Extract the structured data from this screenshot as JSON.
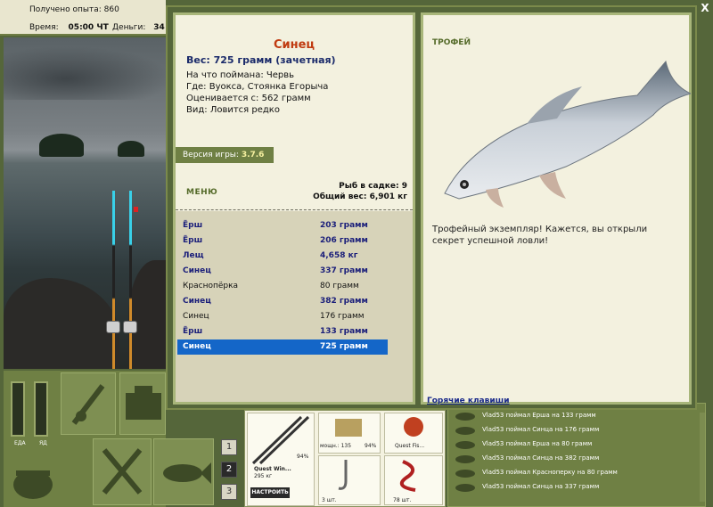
{
  "status": {
    "experience_label": "Получено опыта:",
    "experience_value": "860",
    "time_label": "Время:",
    "time_value": "05:00 ЧТ",
    "money_label": "Деньги:",
    "money_value": "34"
  },
  "gauges": {
    "left_label": "ЕДА",
    "right_label": "ЯД"
  },
  "page_buttons": [
    "1",
    "2",
    "3"
  ],
  "gear": {
    "rod_name": "Quest Win...",
    "rod_weight": "295 кг",
    "rod_percent": "94%",
    "reel_power": "мощн.: 135",
    "reel_percent": "94%",
    "line_name": "Quest Fis...",
    "hook_count": "3 шт.",
    "bait_count": "78 шт.",
    "setup_label": "НАСТРОИТЬ"
  },
  "feed": [
    "Vlad53 поймал Ерша на 133 грамм",
    "Vlad53 поймал Синца на 176 грамм",
    "Vlad53 поймал Ерша на 80 грамм",
    "Vlad53 поймал Синца на 382 грамм",
    "Vlad53 поймал Красноперку на 80 грамм",
    "Vlad53 поймал Синца на 337 грамм"
  ],
  "fish": {
    "name": "Синец",
    "weight_line": "Вес: 725 грамм (зачетная)",
    "caught_on": "На что поймана: Червь",
    "location": "Где: Вуокса, Стоянка Егорыча",
    "valued_from": "Оценивается с: 562 грамм",
    "type": "Вид: Ловится редко"
  },
  "version": {
    "label": "Версия игры:",
    "value": "3.7.6"
  },
  "menu_label": "МЕНЮ",
  "stats": {
    "in_keepnet": "Рыб в садке: 9",
    "total_weight": "Общий вес: 6,901 кг"
  },
  "catches": [
    {
      "name": "Ёрш",
      "weight": "203 грамм",
      "style": "bold"
    },
    {
      "name": "Ёрш",
      "weight": "206 грамм",
      "style": "bold"
    },
    {
      "name": "Лещ",
      "weight": "4,658 кг",
      "style": "bold"
    },
    {
      "name": "Синец",
      "weight": "337 грамм",
      "style": "bold"
    },
    {
      "name": "Краснопёрка",
      "weight": "80 грамм",
      "style": "plain"
    },
    {
      "name": "Синец",
      "weight": "382 грамм",
      "style": "bold"
    },
    {
      "name": "Синец",
      "weight": "176 грамм",
      "style": "plain"
    },
    {
      "name": "Ёрш",
      "weight": "133 грамм",
      "style": "bold"
    },
    {
      "name": "Синец",
      "weight": "725 грамм",
      "style": "sel"
    }
  ],
  "trophy": {
    "label": "ТРОФЕЙ",
    "text": "Трофейный экземпляр! Кажется, вы открыли секрет успешной ловли!"
  },
  "hotkeys": "Горячие клавиши",
  "close": "X",
  "colors": {
    "accent": "#1466c8",
    "fish_name": "#c03a10",
    "panel_green": "#6f8044"
  }
}
